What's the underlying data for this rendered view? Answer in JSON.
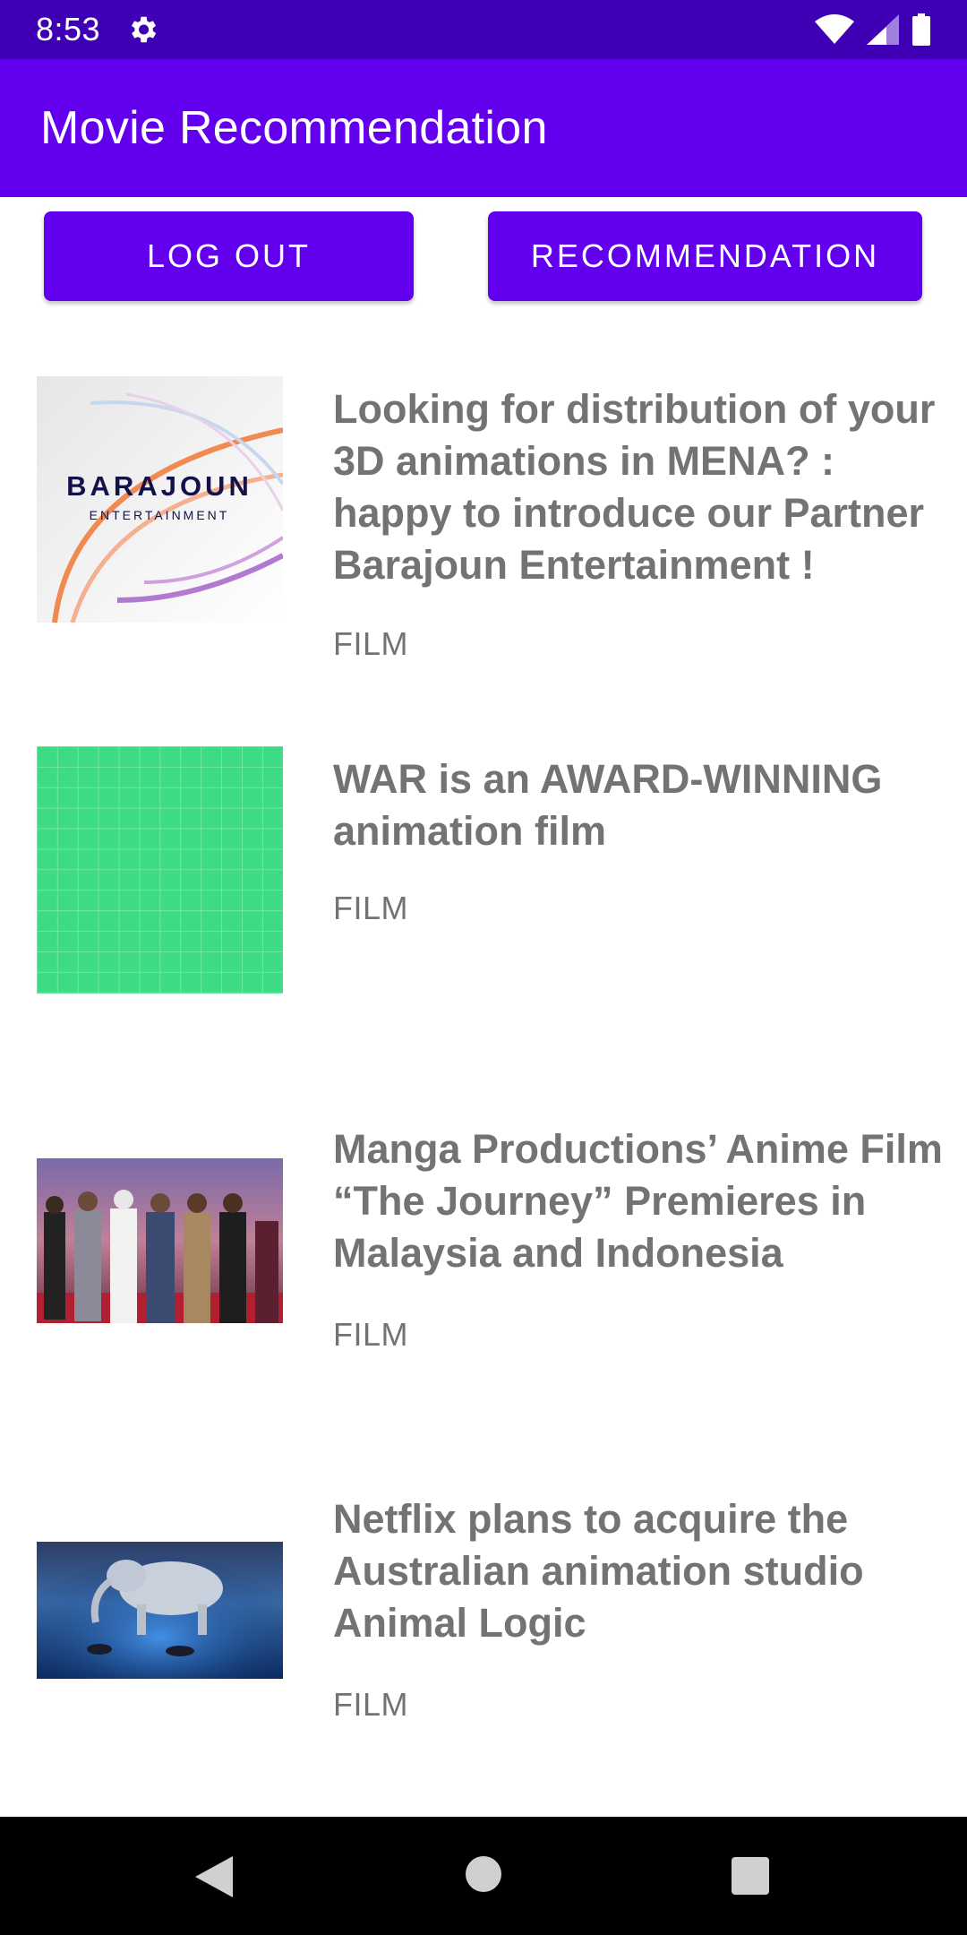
{
  "status_bar": {
    "time": "8:53",
    "icons": [
      "gear-icon",
      "wifi-icon",
      "signal-icon",
      "battery-icon"
    ]
  },
  "app_bar": {
    "title": "Movie Recommendation"
  },
  "buttons": {
    "logout": "LOG OUT",
    "recommendation": "RECOMMENDATION"
  },
  "articles": [
    {
      "title": "Looking for distribution of your 3D animations in MENA? : happy to introduce our Partner Barajoun Entertainment !",
      "category": "FILM",
      "logo_text": "BARAJOUN",
      "logo_subtext": "ENTERTAINMENT"
    },
    {
      "title": "WAR is an AWARD-WINNING animation film",
      "category": "FILM"
    },
    {
      "title": "Manga Productions’ Anime Film “The Journey” Premieres in Malaysia and Indonesia",
      "category": "FILM"
    },
    {
      "title": "Netflix plans to acquire the Australian animation studio Animal Logic",
      "category": "FILM"
    }
  ],
  "nav_bar": {
    "icons": [
      "back-icon",
      "home-icon",
      "recents-icon"
    ]
  },
  "colors": {
    "status_bar": "#3f00b5",
    "primary": "#6200ee",
    "text_gray": "#737373",
    "green_tile": "#3ddc84"
  }
}
